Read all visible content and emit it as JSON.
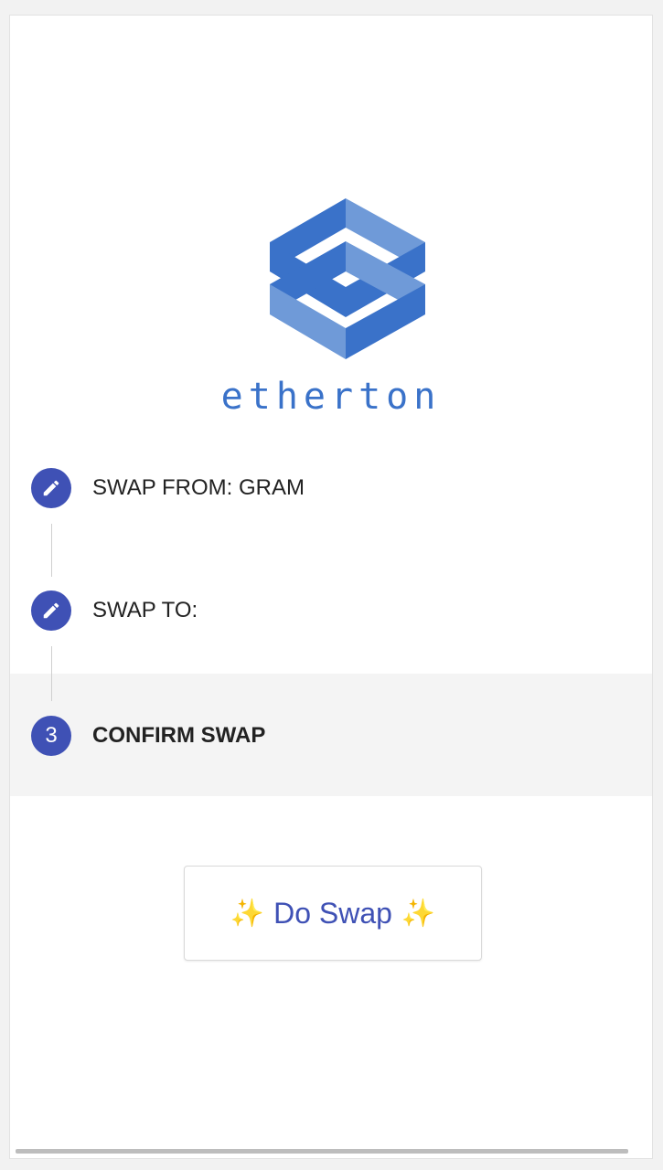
{
  "brand": {
    "name": "etherton",
    "color": "#3a72c9"
  },
  "steps": [
    {
      "label": "SWAP FROM: GRAM",
      "icon": "pencil-icon",
      "state": "done"
    },
    {
      "label": "SWAP TO:",
      "icon": "pencil-icon",
      "state": "done"
    },
    {
      "label": "CONFIRM SWAP",
      "number": "3",
      "state": "active"
    }
  ],
  "action": {
    "sparkle_left": "✨",
    "label": "Do Swap",
    "sparkle_right": "✨"
  },
  "colors": {
    "accent": "#3f51b5",
    "active_step_bg": "#f4f4f4"
  }
}
